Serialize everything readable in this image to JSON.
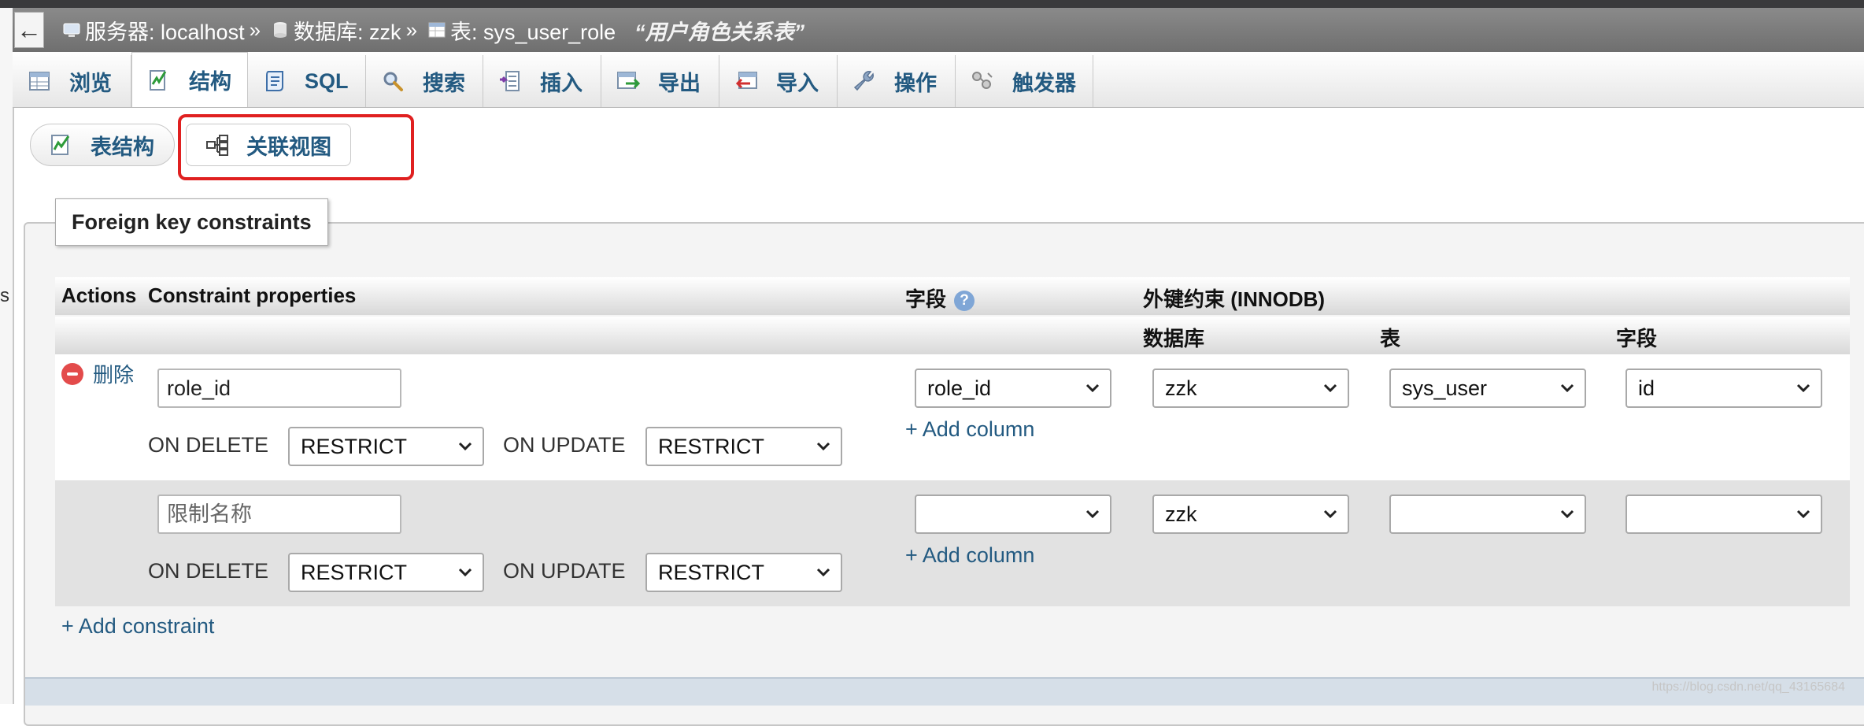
{
  "breadcrumb": {
    "back_label": "←",
    "server": "服务器: localhost",
    "database": "数据库: zzk",
    "table": "表: sys_user_role",
    "separator": "»",
    "comment": "“用户角色关系表”"
  },
  "tabs": [
    {
      "label": "浏览",
      "icon": "browse-icon"
    },
    {
      "label": "结构",
      "icon": "structure-icon",
      "active": true
    },
    {
      "label": "SQL",
      "icon": "sql-icon"
    },
    {
      "label": "搜索",
      "icon": "search-icon"
    },
    {
      "label": "插入",
      "icon": "insert-icon"
    },
    {
      "label": "导出",
      "icon": "export-icon"
    },
    {
      "label": "导入",
      "icon": "import-icon"
    },
    {
      "label": "操作",
      "icon": "wrench-icon"
    },
    {
      "label": "触发器",
      "icon": "triggers-icon"
    }
  ],
  "subtabs": {
    "table_structure": "表结构",
    "relation_view": "关联视图"
  },
  "gutter_text": "s",
  "fieldset": {
    "legend": "Foreign key constraints",
    "headers": {
      "actions": "Actions",
      "constraint_properties": "Constraint properties",
      "column": "字段",
      "foreign_key": "外键约束 (INNODB)",
      "ref_database": "数据库",
      "ref_table": "表",
      "ref_column": "字段"
    },
    "delete_label": "删除",
    "on_delete_label": "ON DELETE",
    "on_update_label": "ON UPDATE",
    "add_column_label": "+ Add column",
    "add_constraint_label": "+ Add constraint",
    "rows": [
      {
        "constraint_name": "role_id",
        "placeholder": "限制名称",
        "on_delete": "RESTRICT",
        "on_update": "RESTRICT",
        "column": "role_id",
        "ref_database": "zzk",
        "ref_table": "sys_user",
        "ref_column": "id"
      },
      {
        "constraint_name": "",
        "placeholder": "限制名称",
        "on_delete": "RESTRICT",
        "on_update": "RESTRICT",
        "column": "",
        "ref_database": "zzk",
        "ref_table": "",
        "ref_column": ""
      }
    ]
  },
  "watermark": "https://blog.csdn.net/qq_43165684",
  "colors": {
    "link": "#235a81",
    "highlight": "#e02020",
    "delete": "#e34b4b"
  }
}
